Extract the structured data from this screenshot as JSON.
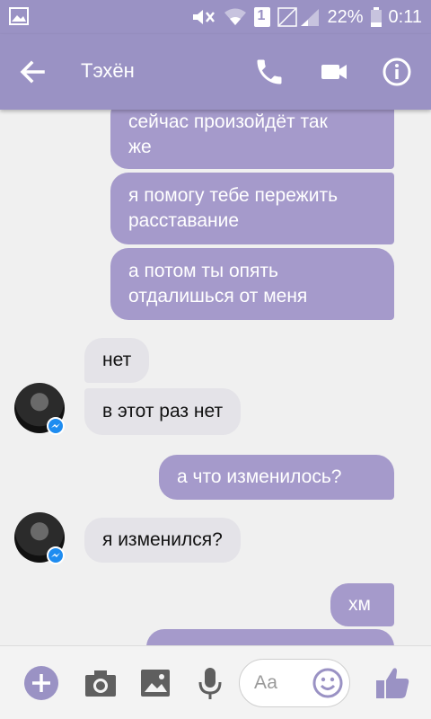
{
  "status_bar": {
    "battery_percent": "22%",
    "time": "0:11",
    "sim_slot": "1",
    "icons": [
      "gallery-icon",
      "mute-icon",
      "wifi-icon",
      "sim-icon",
      "signal-icon",
      "battery-icon"
    ]
  },
  "app_bar": {
    "contact_name": "Тэхён",
    "icons": [
      "back-arrow-icon",
      "phone-icon",
      "video-camera-icon",
      "info-icon"
    ]
  },
  "messages": [
    {
      "side": "out",
      "text_lines": [
        "сейчас произойдёт так",
        "же"
      ]
    },
    {
      "side": "out",
      "text_lines": [
        "я помогу тебе пережить",
        "расставание"
      ]
    },
    {
      "side": "out",
      "text_lines": [
        "а потом ты опять",
        "отдалишься от меня"
      ]
    },
    {
      "side": "in",
      "text_lines": [
        "нет"
      ]
    },
    {
      "side": "in",
      "text_lines": [
        "в этот раз нет"
      ]
    },
    {
      "side": "out",
      "text_lines": [
        "а что изменилось?"
      ]
    },
    {
      "side": "in",
      "text_lines": [
        "я изменился?"
      ]
    },
    {
      "side": "out",
      "text_lines": [
        "хм"
      ]
    }
  ],
  "composer": {
    "placeholder": "Аа",
    "icons": [
      "plus-icon",
      "camera-icon",
      "image-icon",
      "microphone-icon",
      "emoji-icon",
      "thumbs-up-icon"
    ]
  },
  "colors": {
    "accent": "#9a92c4",
    "outgoing_bubble": "#a59acb",
    "incoming_bubble": "#e4e3e8",
    "messenger_badge": "#1e8cf0"
  }
}
